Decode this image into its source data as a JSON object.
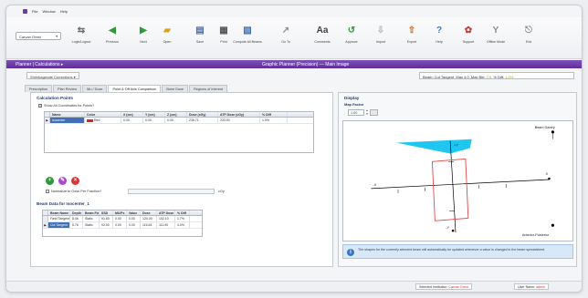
{
  "menu": {
    "items": [
      "File",
      "Window",
      "Help"
    ]
  },
  "toolbar": {
    "combo_value": "Carvan Grest",
    "buttons": [
      {
        "label": "Login/Logout",
        "icon": "login-icon",
        "color": "#6b6f76",
        "glyph": "⇆"
      },
      {
        "label": "Previous",
        "icon": "previous-icon",
        "color": "#2e9a3a",
        "glyph": "◀"
      },
      {
        "label": "Next",
        "icon": "next-icon",
        "color": "#2e9a3a",
        "glyph": "▶"
      },
      {
        "label": "Open",
        "icon": "open-icon",
        "color": "#d9a21b",
        "glyph": "▰"
      },
      {
        "label": "Save",
        "icon": "save-icon",
        "color": "#4a6ea8",
        "glyph": "▤"
      },
      {
        "label": "Print",
        "icon": "print-icon",
        "color": "#555555",
        "glyph": "▦"
      },
      {
        "label": "Compute All Beams",
        "icon": "compute-icon",
        "color": "#3a6fb3",
        "glyph": "▧"
      },
      {
        "label": "Go To",
        "icon": "goto-icon",
        "color": "#8c8f96",
        "glyph": "↗"
      },
      {
        "label": "Comments",
        "icon": "comments-icon",
        "color": "#444444",
        "glyph": "Aa"
      },
      {
        "label": "Approve",
        "icon": "approve-icon",
        "color": "#2e9a3a",
        "glyph": "↺"
      },
      {
        "label": "Import",
        "icon": "import-icon",
        "color": "#b0b4bb",
        "glyph": "⇩"
      },
      {
        "label": "Export",
        "icon": "export-icon",
        "color": "#d6631c",
        "glyph": "⇧"
      },
      {
        "label": "Help",
        "icon": "help-icon",
        "color": "#2f7dd1",
        "glyph": "?"
      },
      {
        "label": "Support",
        "icon": "support-icon",
        "color": "#c73b3b",
        "glyph": "✿"
      },
      {
        "label": "Offline Mode",
        "icon": "offline-icon",
        "color": "#8a8e95",
        "glyph": "Y"
      },
      {
        "label": "Exit",
        "icon": "exit-icon",
        "color": "#8a8e95",
        "glyph": "⎋"
      }
    ]
  },
  "titlebar": {
    "left": "Planner | Calculations ▸",
    "center": "Graphic Planner (Precision) — Main Image"
  },
  "status": {
    "calc_label": "Shrinkagerate Corrections ▾",
    "summary_prefix": "Beam: Cut Tangent",
    "summary_max": "Max 4.0",
    "summary_min_prefix": "Max Ble: ",
    "summary_min": "2.5",
    "summary_pct_prefix": "% Diff: ",
    "summary_pct": "1.0%"
  },
  "tabs": [
    "Prescription",
    "Plan Review",
    "Mu / Dose",
    "Point & Off Axis Comparison",
    "Bone Dose",
    "Regions of Interest"
  ],
  "left": {
    "calc_heading": "Calculation Points",
    "show_all_label": "Show All Coordinates for Points?",
    "points_columns": [
      "Name",
      "Color",
      "X (cm)",
      "Y (cm)",
      "Z (cm)",
      "Dose (cGy)",
      "ATP Dose (cGy)",
      "% Diff"
    ],
    "points_rows": [
      [
        "Isocenter",
        "Red",
        "0.00",
        "0.00",
        "0.00",
        "236.71",
        "233.50",
        "1.0%"
      ]
    ],
    "normalize_label": "Normalize to Dose Per Fraction?",
    "normalize_unit": "cGy",
    "beam_heading": "Beam Data for Isocenter_1",
    "beam_columns": [
      "Beam Name",
      "Depth",
      "Beam Field",
      "SSD",
      "MU/Fx",
      "Value",
      "Dose",
      "ATP Dose",
      "% Diff"
    ],
    "beam_rows": [
      [
        "Field Tangent",
        "8.46",
        "Static",
        "91.60",
        "0.00",
        "0.00",
        "120.00",
        "102.10",
        "1.7%"
      ],
      [
        "Cut Tangent",
        "5.76",
        "Static",
        "92.00",
        "0.00",
        "0.00",
        "116.64",
        "111.90",
        "4.0%"
      ]
    ]
  },
  "right": {
    "heading": "Display",
    "sub_heading": "Map Factor",
    "zoom_value": "1.00",
    "plot_labels": {
      "top_right": "Beam Gantry",
      "bottom_right": "Anterior-Posterior",
      "left_axis": "-X",
      "right_axis": "X",
      "top_axis": "+Y",
      "bottom_axis": "-Y"
    },
    "info_text": "The shapes for the currently selected beam will automatically be updated whenever a value is changed in the beam spreadsheet."
  },
  "footer": {
    "institution_prefix": "Selected Institution: ",
    "institution": "Carvan Grest",
    "user_prefix": "User Name: ",
    "user": "admin"
  }
}
